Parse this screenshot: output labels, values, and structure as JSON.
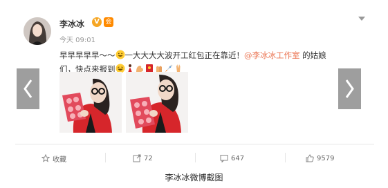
{
  "post": {
    "author": "李冰冰",
    "verified_badge": "V",
    "member_badge": "会",
    "time": "今天 09:01",
    "text_line1_a": "早早早早早～～",
    "text_line1_b": "一大大大大波开工红包正在靠近！",
    "mention": "@李冰冰工作室",
    "text_line1_c": " 的姑娘",
    "text_line2": "们，快点来报到"
  },
  "actions": {
    "favorite": "收藏",
    "repost": "72",
    "comment": "647",
    "like": "9579"
  },
  "caption": "李冰冰微博截图",
  "colors": {
    "mention": "#eb7350",
    "red_coat": "#d6262b",
    "badge_orange": "#f6a623"
  },
  "icons": [
    "chevron-left-icon",
    "chevron-right-icon",
    "star-icon",
    "repost-icon",
    "comment-icon",
    "thumbs-up-icon",
    "caret-down-icon"
  ]
}
